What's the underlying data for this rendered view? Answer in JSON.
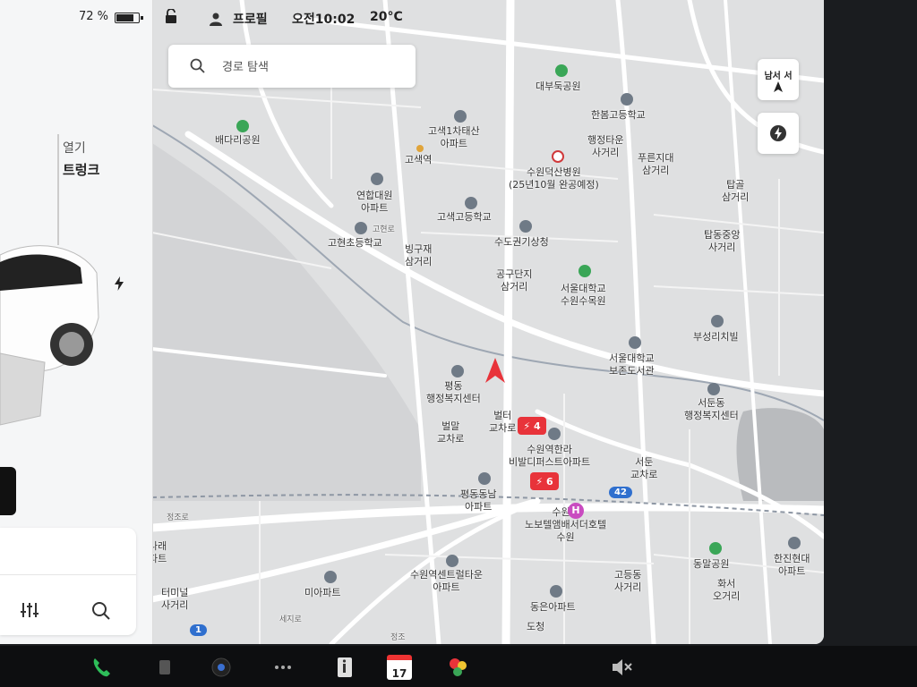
{
  "status": {
    "battery_percent": "72 %",
    "battery_level": 0.72,
    "profile_label": "프로필",
    "time": "오전10:02",
    "temperature": "20°C"
  },
  "car_panel": {
    "trunk_open_label": "열기",
    "trunk_label": "트렁크"
  },
  "search": {
    "placeholder": "경로 탐색"
  },
  "map_controls": {
    "heading_label": "남서 서"
  },
  "map": {
    "labels": [
      {
        "text": "대부둑공원",
        "type": "green"
      },
      {
        "text": "한봄고등학교",
        "type": "gray"
      },
      {
        "text": "배다리공원",
        "type": "green"
      },
      {
        "text": "고색1차태산\n아파트",
        "type": "gray"
      },
      {
        "text": "고색역",
        "type": "station"
      },
      {
        "text": "행정타운\n사거리",
        "type": "none"
      },
      {
        "text": "푸른지대\n삼거리",
        "type": "none"
      },
      {
        "text": "수원덕산병원\n(25년10월 완공예정)",
        "type": "red"
      },
      {
        "text": "탑골\n삼거리",
        "type": "none"
      },
      {
        "text": "연합대원\n아파트",
        "type": "gray"
      },
      {
        "text": "고색고등학교",
        "type": "gray"
      },
      {
        "text": "고현초등학교",
        "type": "gray"
      },
      {
        "text": "수도권기상청",
        "type": "gray"
      },
      {
        "text": "탑동중앙\n사거리",
        "type": "none"
      },
      {
        "text": "빙구재\n삼거리",
        "type": "none"
      },
      {
        "text": "공구단지\n삼거리",
        "type": "none"
      },
      {
        "text": "서울대학교\n수원수목원",
        "type": "green"
      },
      {
        "text": "부성리치빌",
        "type": "gray"
      },
      {
        "text": "서울대학교\n보존도서관",
        "type": "gray"
      },
      {
        "text": "평동\n행정복지센터",
        "type": "gray"
      },
      {
        "text": "서둔동\n행정복지센터",
        "type": "gray"
      },
      {
        "text": "벌터\n교차로",
        "type": "none"
      },
      {
        "text": "벌말\n교차로",
        "type": "none"
      },
      {
        "text": "수원역한라\n비발디퍼스트아파트",
        "type": "gray"
      },
      {
        "text": "서둔\n교차로",
        "type": "none"
      },
      {
        "text": "평동동남\n아파트",
        "type": "gray"
      },
      {
        "text": "수원역\n노보텔앰배서더호텔\n수원",
        "type": "none"
      },
      {
        "text": "동말공원",
        "type": "green"
      },
      {
        "text": "한진현대\n아파트",
        "type": "gray"
      },
      {
        "text": "나래\n파트",
        "type": "none"
      },
      {
        "text": "수원역센트럴타운\n아파트",
        "type": "gray"
      },
      {
        "text": "고등동\n사거리",
        "type": "none"
      },
      {
        "text": "화서\n오거리",
        "type": "none"
      },
      {
        "text": "미아파트",
        "type": "gray"
      },
      {
        "text": "동은아파트",
        "type": "gray"
      },
      {
        "text": "터미널\n사거리",
        "type": "none"
      },
      {
        "text": "도청",
        "type": "none"
      },
      {
        "text": "고현로",
        "type": "street"
      },
      {
        "text": "정조로",
        "type": "street"
      },
      {
        "text": "세지로",
        "type": "street"
      },
      {
        "text": "정조",
        "type": "street"
      }
    ],
    "chargers": [
      {
        "count": "4"
      },
      {
        "count": "6"
      }
    ],
    "road_shields": [
      "42",
      "1"
    ],
    "hotel_marker": "H"
  },
  "dock": {
    "calendar_date": "17",
    "items": [
      "phone-icon",
      "music-icon",
      "camera-icon",
      "more-icon",
      "energy-icon",
      "calendar-icon",
      "games-icon",
      "volume-mute-icon"
    ]
  },
  "colors": {
    "map_background": "#dfe0e1",
    "road": "#ffffff",
    "charger_red": "#e8333a",
    "nav_arrow_red": "#e8333a",
    "poi_green": "#3aa657",
    "poi_gray": "#6f7a86",
    "road_shield_blue": "#2f6fce"
  }
}
